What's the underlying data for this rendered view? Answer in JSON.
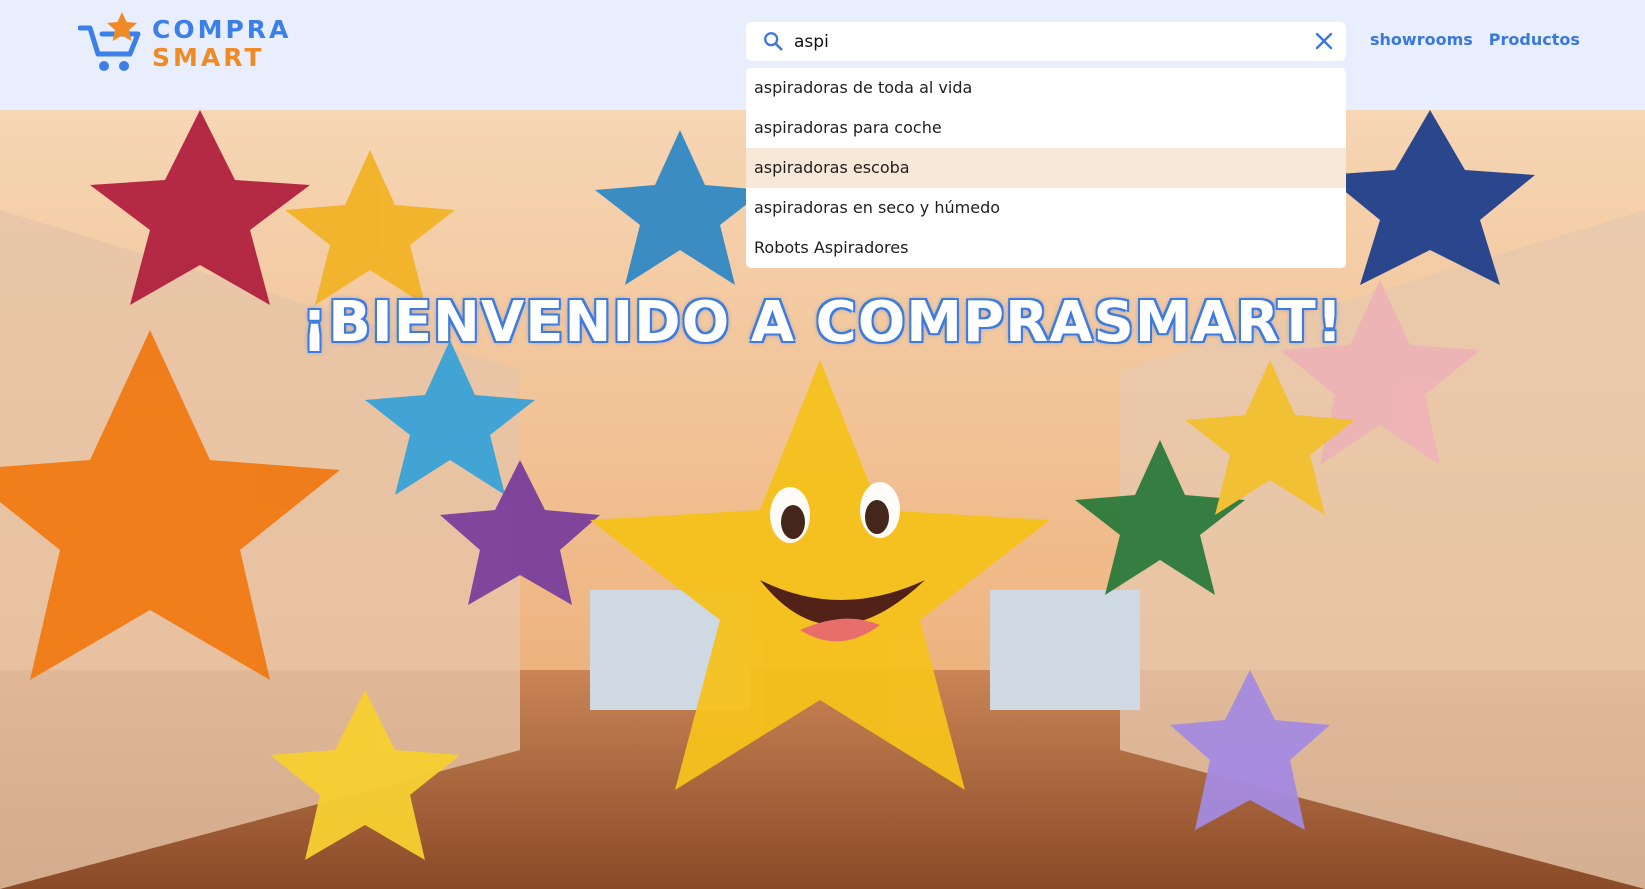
{
  "brand": {
    "line1": "COMPRA",
    "line2": "SMART",
    "logo_icon": "cart-star-icon",
    "color_blue": "#3c7fe6",
    "color_orange": "#f08a25"
  },
  "search": {
    "value": "aspi",
    "placeholder": "",
    "icon": "search-icon",
    "clear_icon": "close-icon"
  },
  "suggestions": [
    {
      "label": "aspiradoras de toda al vida"
    },
    {
      "label": "aspiradoras para coche"
    },
    {
      "label": "aspiradoras escoba"
    },
    {
      "label": "aspiradoras en seco y húmedo"
    },
    {
      "label": "Robots Aspiradores"
    }
  ],
  "nav": {
    "showrooms": "showrooms",
    "productos": "Productos"
  },
  "hero": {
    "title": "¡BIENVENIDO A COMPRASMART!"
  }
}
